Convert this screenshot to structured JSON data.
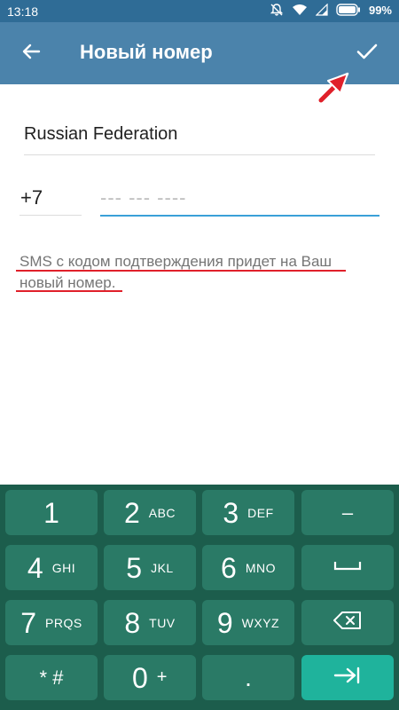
{
  "status_bar": {
    "time": "13:18",
    "battery": "99%",
    "icons": [
      "notifications-off-icon",
      "wifi-icon",
      "signal-icon",
      "battery-icon"
    ]
  },
  "action_bar": {
    "title": "Новый номер",
    "back_icon": "arrow-left-icon",
    "confirm_icon": "checkmark-icon",
    "background": "#4b83ab"
  },
  "form": {
    "country": "Russian Federation",
    "country_code": "+7",
    "phone_value": "",
    "phone_placeholder": "--- --- ----",
    "info_line1": "SMS с кодом подтверждения придет на Ваш",
    "info_line2": "новый номер."
  },
  "keypad": {
    "keys": [
      {
        "main": "1",
        "sub": ""
      },
      {
        "main": "2",
        "sub": "ABC"
      },
      {
        "main": "3",
        "sub": "DEF"
      },
      {
        "main": "–",
        "sub": ""
      },
      {
        "main": "4",
        "sub": "GHI"
      },
      {
        "main": "5",
        "sub": "JKL"
      },
      {
        "main": "6",
        "sub": "MNO"
      },
      {
        "main": "space",
        "sub": ""
      },
      {
        "main": "7",
        "sub": "PRQS"
      },
      {
        "main": "8",
        "sub": "TUV"
      },
      {
        "main": "9",
        "sub": "WXYZ"
      },
      {
        "main": "backspace",
        "sub": ""
      },
      {
        "main": "* #",
        "sub": ""
      },
      {
        "main": "0",
        "sub": "+"
      },
      {
        "main": ".",
        "sub": ""
      },
      {
        "main": "next",
        "sub": ""
      }
    ],
    "colors": {
      "background": "#1c5d4c",
      "key": "#2a7a66",
      "accent": "#1fb39c"
    }
  },
  "annotation_color": "#e0202a"
}
